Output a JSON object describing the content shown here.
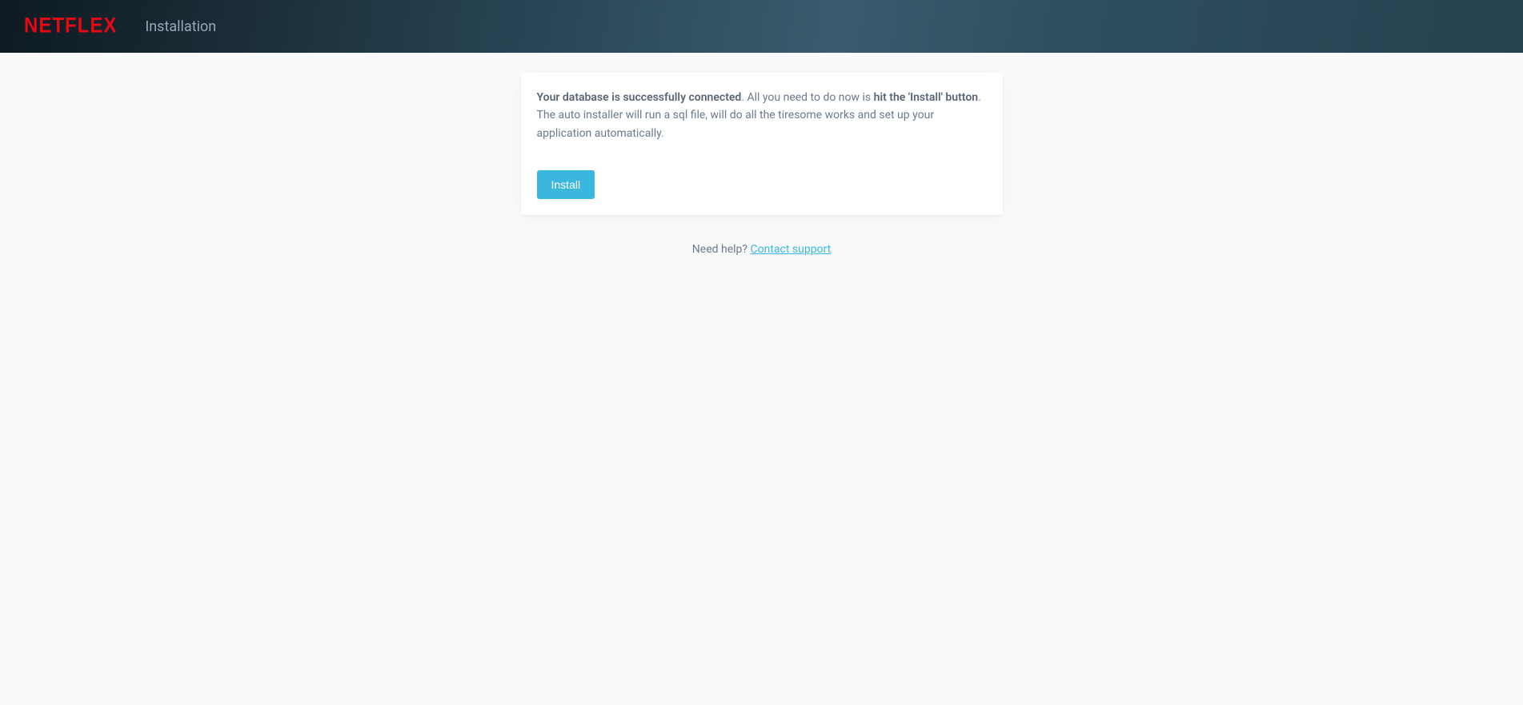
{
  "header": {
    "logo": "NETFLEX",
    "title": "Installation"
  },
  "card": {
    "message_strong1": "Your database is successfully connected",
    "message_part1": ". All you need to do now is ",
    "message_strong2": "hit the 'Install' button",
    "message_part2": ". The auto installer will run a sql file, will do all the tiresome works and set up your application automatically.",
    "install_button": "Install"
  },
  "footer": {
    "help_text": "Need help? ",
    "help_link": "Contact support"
  }
}
